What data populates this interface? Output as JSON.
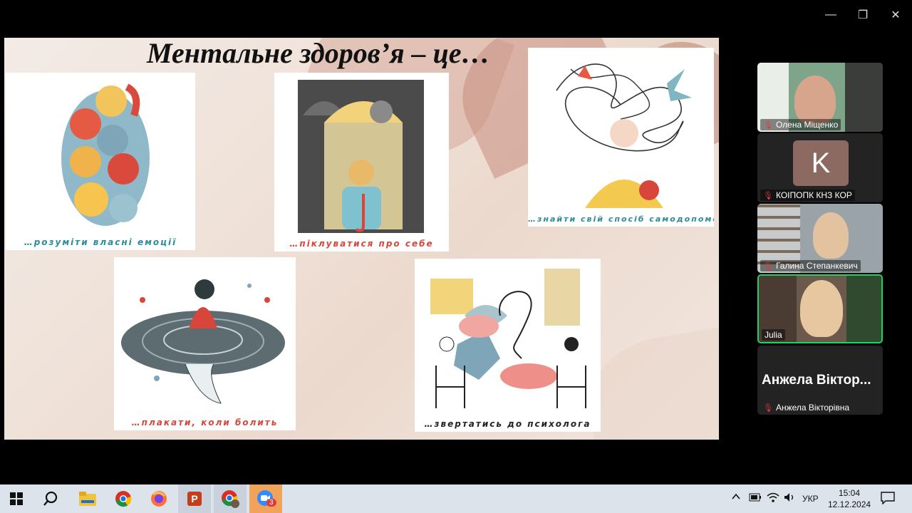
{
  "window": {
    "minimize_icon": "—",
    "restore_icon": "❐",
    "close_icon": "✕"
  },
  "slide": {
    "title": "Ментальне здоров’я – це…",
    "cards": [
      {
        "caption": "…розуміти власні емоції",
        "color": "#2a8d9c"
      },
      {
        "caption": "…піклуватися про себе",
        "color": "#d8453b"
      },
      {
        "caption": "…знайти свій спосіб самодопомоги",
        "color": "#2a8d9c"
      },
      {
        "caption": "…плакати, коли болить",
        "color": "#d8453b"
      },
      {
        "caption": "…звертатись до психолога",
        "color": "#222222"
      }
    ]
  },
  "participants": [
    {
      "name": "Олена Міщенко",
      "muted": true
    },
    {
      "name": "КОІПОПК КНЗ КОР",
      "avatar_letter": "K",
      "muted": true
    },
    {
      "name": "Галина Степанкевич",
      "muted": true
    },
    {
      "name": "Julia",
      "muted": false,
      "active_speaker": true
    },
    {
      "name": "Анжела Вікторівна",
      "display_name": "Анжела Віктор...",
      "muted": true
    }
  ],
  "taskbar": {
    "apps": [
      "windows-start",
      "search",
      "file-explorer",
      "chrome",
      "firefox",
      "powerpoint",
      "chrome-profile",
      "zoom"
    ],
    "zoom_badge": "3",
    "lang": "УКР",
    "time": "15:04",
    "date": "12.12.2024"
  }
}
